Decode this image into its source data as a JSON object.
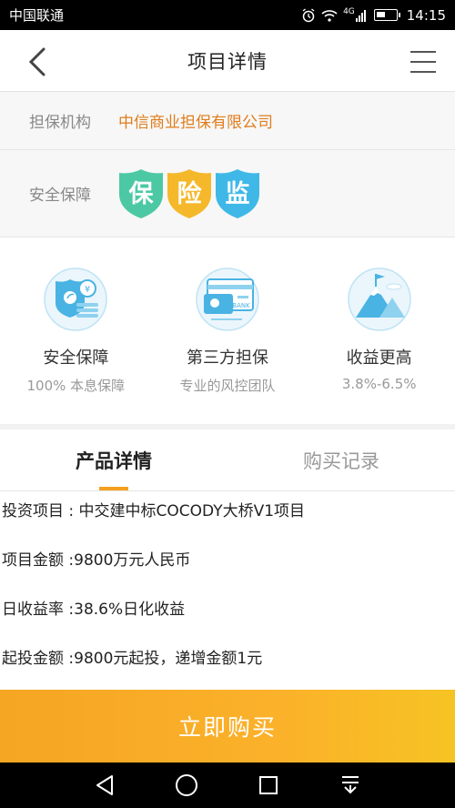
{
  "status_bar": {
    "carrier": "中国联通",
    "network": "4G",
    "time": "14:15"
  },
  "nav": {
    "title": "项目详情"
  },
  "guarantor": {
    "label": "担保机构",
    "value": "中信商业担保有限公司"
  },
  "security": {
    "label": "安全保障",
    "badges": [
      {
        "char": "保",
        "color": "#4cc9a4"
      },
      {
        "char": "险",
        "color": "#f5b82a"
      },
      {
        "char": "监",
        "color": "#3fb8e8"
      }
    ]
  },
  "features": [
    {
      "title": "安全保障",
      "sub": "100% 本息保障",
      "icon": "shield-money-icon"
    },
    {
      "title": "第三方担保",
      "sub": "专业的风控团队",
      "icon": "bank-card-icon"
    },
    {
      "title": "收益更高",
      "sub": "3.8%-6.5%",
      "icon": "mountain-flag-icon"
    }
  ],
  "tabs": [
    {
      "label": "产品详情",
      "active": true
    },
    {
      "label": "购买记录",
      "active": false
    }
  ],
  "details": [
    "投资项目 : 中交建中标COCODY大桥V1项目",
    "项目金额 :9800万元人民币",
    "日收益率 :38.6%日化收益",
    "起投金额 :9800元起投，递增金额1元"
  ],
  "buy_button": {
    "label": "立即购买"
  },
  "colors": {
    "accent_orange": "#f5a623",
    "guarantor_text": "#e07d1c",
    "icon_blue": "#3fb8e8"
  }
}
